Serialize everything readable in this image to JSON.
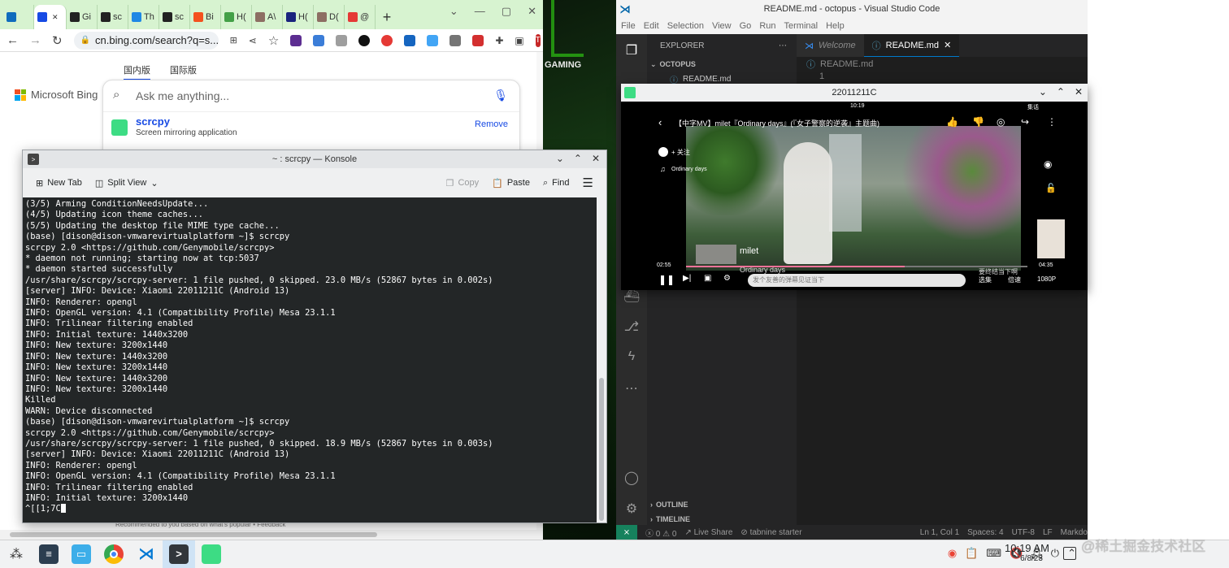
{
  "chrome": {
    "tabs": [
      {
        "label": "",
        "icon": "bird-icon",
        "color": "#0f6cbd"
      },
      {
        "label": "",
        "icon": "search-icon",
        "color": "#174ae4",
        "active": true
      },
      {
        "label": "Gi",
        "icon": "github-icon",
        "color": "#222222"
      },
      {
        "label": "sc",
        "icon": "github-icon",
        "color": "#222222"
      },
      {
        "label": "Th",
        "icon": "page-icon",
        "color": "#1e88e5"
      },
      {
        "label": "sc",
        "icon": "github-icon",
        "color": "#222222"
      },
      {
        "label": "Bi",
        "icon": "k-icon",
        "color": "#f4511e"
      },
      {
        "label": "H(",
        "icon": "handshake-icon",
        "color": "#43a047"
      },
      {
        "label": "A\\",
        "icon": "puzzle-icon",
        "color": "#8d6e63"
      },
      {
        "label": "H(",
        "icon": "k-icon",
        "color": "#1a237e"
      },
      {
        "label": "D(",
        "icon": "puzzle-icon",
        "color": "#8d6e63"
      },
      {
        "label": "@",
        "icon": "pocket-icon",
        "color": "#e53935"
      }
    ],
    "new_tab": "+",
    "address": "cn.bing.com/search?q=s...",
    "bing_tabs": [
      "国内版",
      "国际版"
    ],
    "brand": "Microsoft Bing",
    "search_placeholder": "Ask me anything...",
    "suggestion": {
      "title": "scrcpy",
      "subtitle": "Screen mirroring application",
      "action": "Remove"
    },
    "footer": "Recommended to you based on what's popular • Feedback",
    "profile_initial": "T"
  },
  "konsole": {
    "title": "~ : scrcpy — Konsole",
    "toolbar": {
      "new_tab": "New Tab",
      "split_view": "Split View",
      "copy": "Copy",
      "paste": "Paste",
      "find": "Find"
    },
    "lines": [
      "(3/5) Arming ConditionNeedsUpdate...",
      "(4/5) Updating icon theme caches...",
      "(5/5) Updating the desktop file MIME type cache...",
      "(base) [dison@dison-vmwarevirtualplatform ~]$ scrcpy",
      "scrcpy 2.0 <https://github.com/Genymobile/scrcpy>",
      "* daemon not running; starting now at tcp:5037",
      "* daemon started successfully",
      "/usr/share/scrcpy/scrcpy-server: 1 file pushed, 0 skipped. 23.0 MB/s (52867 bytes in 0.002s)",
      "[server] INFO: Device: Xiaomi 22011211C (Android 13)",
      "INFO: Renderer: opengl",
      "INFO: OpenGL version: 4.1 (Compatibility Profile) Mesa 23.1.1",
      "INFO: Trilinear filtering enabled",
      "INFO: Initial texture: 1440x3200",
      "INFO: New texture: 3200x1440",
      "INFO: New texture: 1440x3200",
      "INFO: New texture: 3200x1440",
      "INFO: New texture: 1440x3200",
      "INFO: New texture: 3200x1440",
      "Killed",
      "WARN: Device disconnected",
      "(base) [dison@dison-vmwarevirtualplatform ~]$ scrcpy",
      "scrcpy 2.0 <https://github.com/Genymobile/scrcpy>",
      "/usr/share/scrcpy/scrcpy-server: 1 file pushed, 0 skipped. 18.9 MB/s (52867 bytes in 0.003s)",
      "[server] INFO: Device: Xiaomi 22011211C (Android 13)",
      "INFO: Renderer: opengl",
      "INFO: OpenGL version: 4.1 (Compatibility Profile) Mesa 23.1.1",
      "INFO: Trilinear filtering enabled",
      "INFO: Initial texture: 3200x1440"
    ],
    "prompt_line": "^[[1;7C"
  },
  "desktop": {
    "text": "GAMING"
  },
  "vscode": {
    "title": "README.md - octopus - Visual Studio Code",
    "menu": [
      "File",
      "Edit",
      "Selection",
      "View",
      "Go",
      "Run",
      "Terminal",
      "Help"
    ],
    "explorer_label": "EXPLORER",
    "project": "OCTOPUS",
    "file": "README.md",
    "tabs": [
      {
        "label": "Welcome"
      },
      {
        "label": "README.md",
        "active": true
      }
    ],
    "breadcrumb": "README.md",
    "line_number": "1",
    "outline": "OUTLINE",
    "timeline": "TIMELINE",
    "status": {
      "errors": "0",
      "warnings": "0",
      "live_share": "Live Share",
      "tabnine": "tabnine starter",
      "position": "Ln 1, Col 1",
      "spaces": "Spaces: 4",
      "encoding": "UTF-8",
      "eol": "LF",
      "language": "Markdo"
    }
  },
  "scrcpy": {
    "title": "22011211C",
    "time": "10:19",
    "video_title": "【中字MV】milet『Ordinary days』(『女子警察的逆袭』主题曲)",
    "follow": "+ 关注",
    "song": "Ordinary days",
    "elapsed": "02:55",
    "duration": "04:35",
    "progress": 0.64,
    "danmu_placeholder": "发个友善的弹幕见证当下",
    "select": "选集",
    "speed": "倍速",
    "quality": "1080P",
    "overlay_name": "milet",
    "overlay_song": "Ordinary days",
    "subtitle_right": "要终结当下啊",
    "top_label": "集话"
  },
  "taskbar": {
    "clock_time": "10:19 AM",
    "clock_date": "6/8/23"
  },
  "watermark": "@稀土掘金技术社区"
}
